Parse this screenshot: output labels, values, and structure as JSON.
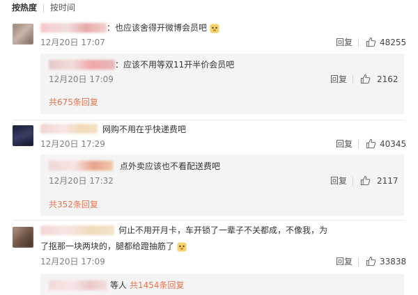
{
  "sort": {
    "hot_label": "按热度",
    "time_label": "按时间"
  },
  "comments": [
    {
      "text": "：也应该舍得开微博会员吧",
      "time": "12月20日 17:07",
      "reply_label": "回复",
      "likes": "48255",
      "reply": {
        "text": "：应该不用等双11开半价会员吧",
        "time": "12月20日 17:09",
        "reply_label": "回复",
        "likes": "2162"
      },
      "total_replies": "共675条回复"
    },
    {
      "text": "网购不用在乎快递费吧",
      "time": "12月20日 17:29",
      "reply_label": "回复",
      "likes": "40345",
      "reply": {
        "text": "点外卖应该也不看配送费吧",
        "time": "12月20日 17:32",
        "reply_label": "回复",
        "likes": "2117"
      },
      "total_replies": "共352条回复"
    },
    {
      "text": "何止不用开月卡，车开锁了一辈子不关都成，不像我，为了抠那一块两块的，腿都给蹬抽筋了",
      "time": "12月20日 17:09",
      "reply_label": "回复",
      "likes": "33838",
      "reply_summary": {
        "prefix": "等人",
        "total": "共1454条回复"
      }
    }
  ],
  "colors": {
    "accent": "#eb7350",
    "time": "#808080",
    "reply_bg": "#f4f4f4"
  },
  "icons": {
    "like": "thumbs-up-icon",
    "emoji": "dog-face-emoji-icon"
  }
}
